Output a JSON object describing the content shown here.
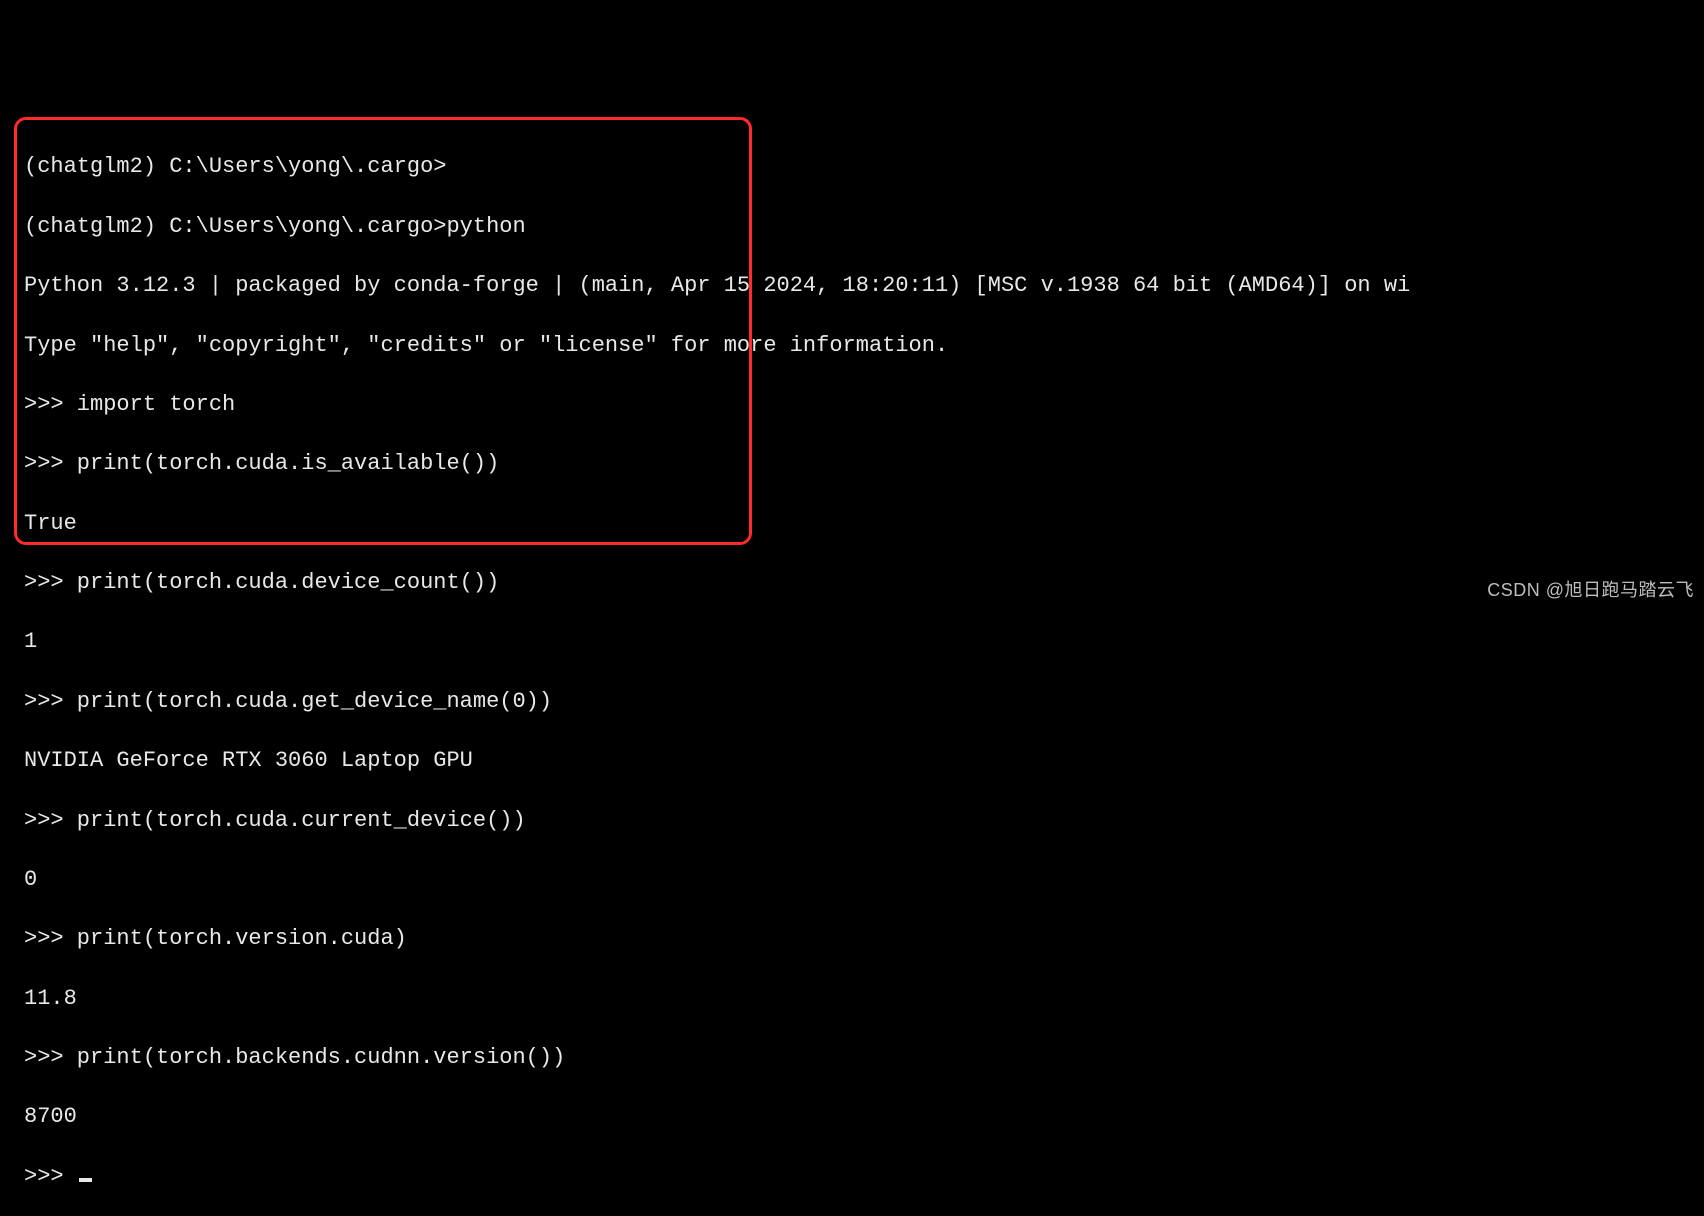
{
  "terminal": {
    "lines": [
      "(chatglm2) C:\\Users\\yong\\.cargo>",
      "(chatglm2) C:\\Users\\yong\\.cargo>python",
      "Python 3.12.3 | packaged by conda-forge | (main, Apr 15 2024, 18:20:11) [MSC v.1938 64 bit (AMD64)] on wi",
      "Type \"help\", \"copyright\", \"credits\" or \"license\" for more information.",
      ">>> import torch",
      ">>> print(torch.cuda.is_available())",
      "True",
      ">>> print(torch.cuda.device_count())",
      "1",
      ">>> print(torch.cuda.get_device_name(0))",
      "NVIDIA GeForce RTX 3060 Laptop GPU",
      ">>> print(torch.cuda.current_device())",
      "0",
      ">>> print(torch.version.cuda)",
      "11.8",
      ">>> print(torch.backends.cudnn.version())",
      "8700",
      ">>> "
    ]
  },
  "watermark": "CSDN @旭日跑马踏云飞"
}
